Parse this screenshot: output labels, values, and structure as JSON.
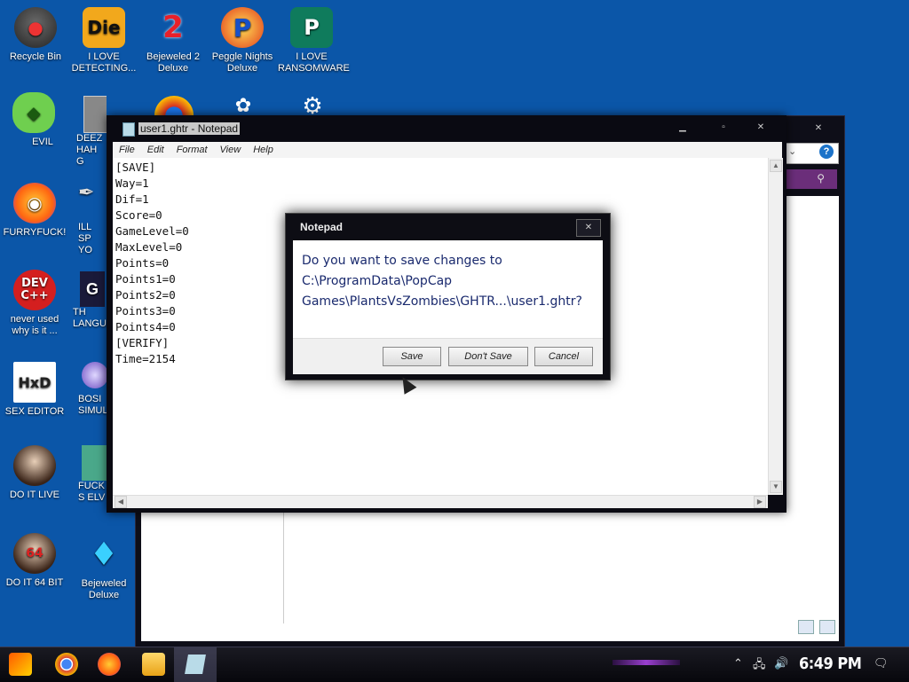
{
  "desktop": {
    "icons_col1": [
      {
        "label": "Recycle Bin",
        "icon": "recycle-bin-icon"
      },
      {
        "label": "EVIL",
        "icon": "peridot-icon"
      },
      {
        "label": "FURRYFUCK!",
        "icon": "firefox-icon"
      },
      {
        "label": "never used why is it ...",
        "icon": "devcpp-icon"
      },
      {
        "label": "SEX EDITOR",
        "icon": "hxd-icon"
      },
      {
        "label": "DO IT LIVE",
        "icon": "portrait-icon"
      },
      {
        "label": "DO IT 64 BIT",
        "icon": "portrait-64-icon"
      }
    ],
    "icons_top": [
      {
        "label": "I LOVE DETECTING...",
        "icon": "die-icon"
      },
      {
        "label": "Bejeweled 2 Deluxe",
        "icon": "bejeweled2-icon"
      },
      {
        "label": "Peggle Nights Deluxe",
        "icon": "peggle-icon"
      },
      {
        "label": "I LOVE RANSOMWARE",
        "icon": "publisher-icon"
      }
    ],
    "icons_col2_partial": [
      {
        "label": "DEEZ HAH G",
        "icon": "files-icon"
      },
      {
        "label": "ILL SP YO",
        "icon": "tool-icon"
      },
      {
        "label": "TH LANGUA",
        "icon": "g-icon"
      },
      {
        "label": "BOSI SIMUL",
        "icon": "ball-icon"
      },
      {
        "label": "FUCK S ELV",
        "icon": "game-icon"
      },
      {
        "label": "Bejeweled Deluxe",
        "icon": "diamond-icon"
      }
    ]
  },
  "notepad": {
    "title": "user1.ghtr - Notepad",
    "menu": [
      "File",
      "Edit",
      "Format",
      "View",
      "Help"
    ],
    "content": "[SAVE]\nWay=1\nDif=1\nScore=0\nGameLevel=0\nMaxLevel=0\nPoints=0\nPoints1=0\nPoints2=0\nPoints3=0\nPoints4=0\n[VERIFY]\nTime=2154"
  },
  "dialog": {
    "title": "Notepad",
    "message_line1": "Do you want to save changes to",
    "message_line2": "C:\\ProgramData\\PopCap",
    "message_line3": "Games\\PlantsVsZombies\\GHTR...\\user1.ghtr?",
    "save": "Save",
    "dont_save": "Don't Save",
    "cancel": "Cancel"
  },
  "taskbar": {
    "clock": "6:49 PM",
    "apps": [
      "start-button",
      "chrome-icon",
      "firefox-icon",
      "file-explorer-icon",
      "notepad-icon"
    ]
  }
}
